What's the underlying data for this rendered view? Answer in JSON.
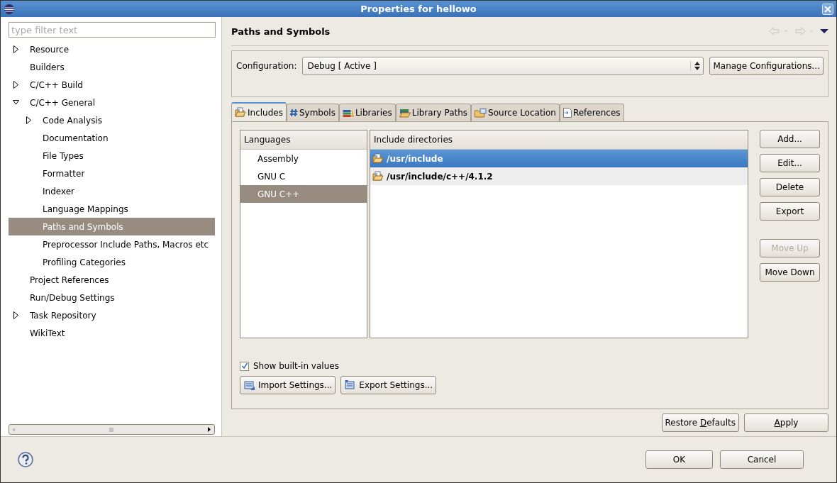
{
  "window": {
    "title": "Properties for hellowo"
  },
  "filter": {
    "placeholder": "type filter text"
  },
  "tree": [
    {
      "label": "Resource",
      "expanded": false,
      "selected": false
    },
    {
      "label": "Builders",
      "selected": false
    },
    {
      "label": "C/C++ Build",
      "expanded": false,
      "selected": false
    },
    {
      "label": "C/C++ General",
      "expanded": true,
      "selected": false,
      "children": [
        {
          "label": "Code Analysis",
          "expanded": false,
          "selected": false
        },
        {
          "label": "Documentation",
          "selected": false
        },
        {
          "label": "File Types",
          "selected": false
        },
        {
          "label": "Formatter",
          "selected": false
        },
        {
          "label": "Indexer",
          "selected": false
        },
        {
          "label": "Language Mappings",
          "selected": false
        },
        {
          "label": "Paths and Symbols",
          "selected": true
        },
        {
          "label": "Preprocessor Include Paths, Macros etc",
          "selected": false
        },
        {
          "label": "Profiling Categories",
          "selected": false
        }
      ]
    },
    {
      "label": "Project References",
      "selected": false
    },
    {
      "label": "Run/Debug Settings",
      "selected": false
    },
    {
      "label": "Task Repository",
      "expanded": false,
      "selected": false
    },
    {
      "label": "WikiText",
      "selected": false
    }
  ],
  "page_title": "Paths and Symbols",
  "configuration": {
    "label": "Configuration:",
    "value": "Debug  [ Active ]",
    "button": "Manage Configurations..."
  },
  "tabs": [
    {
      "label": "Includes",
      "selected": true
    },
    {
      "label": "Symbols",
      "selected": false
    },
    {
      "label": "Libraries",
      "selected": false
    },
    {
      "label": "Library Paths",
      "selected": false
    },
    {
      "label": "Source Location",
      "selected": false
    },
    {
      "label": "References",
      "selected": false
    }
  ],
  "languages": {
    "header": "Languages",
    "items": [
      {
        "label": "Assembly",
        "selected": false
      },
      {
        "label": "GNU C",
        "selected": false
      },
      {
        "label": "GNU C++",
        "selected": true
      }
    ]
  },
  "include_directories": {
    "header": "Include directories",
    "rows": [
      {
        "label": "/usr/include",
        "selected": true
      },
      {
        "label": "/usr/include/c++/4.1.2",
        "selected": false
      }
    ]
  },
  "side_buttons": [
    {
      "label": "Add...",
      "disabled": false
    },
    {
      "label": "Edit...",
      "disabled": false
    },
    {
      "label": "Delete",
      "disabled": false
    },
    {
      "label": "Export",
      "disabled": false
    },
    {
      "label": "Move Up",
      "disabled": true
    },
    {
      "label": "Move Down",
      "disabled": false
    }
  ],
  "show_builtin": {
    "label": "Show built-in values",
    "checked": true
  },
  "settings_buttons": [
    "Import Settings...",
    "Export Settings..."
  ],
  "page_buttons": [
    {
      "before": "Restore ",
      "key": "D",
      "after": "efaults"
    },
    {
      "key": "A",
      "after": "pply"
    }
  ],
  "dialog_buttons": [
    "OK",
    "Cancel"
  ]
}
